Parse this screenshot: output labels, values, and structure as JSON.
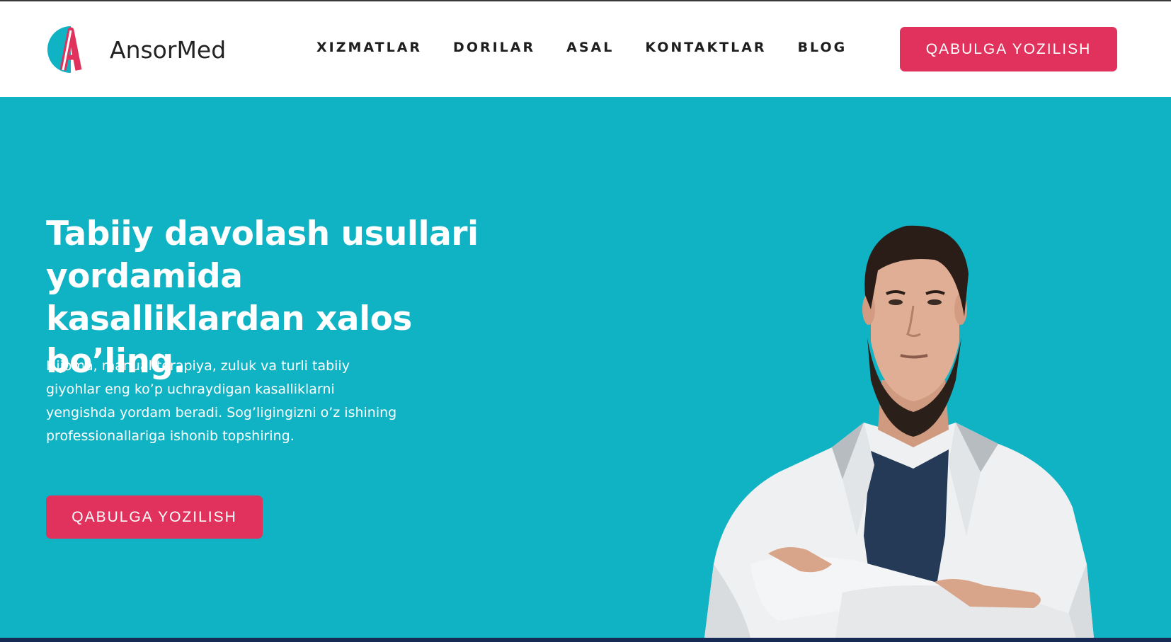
{
  "brand": {
    "name": "AnsorMed",
    "colors": {
      "primary": "#e0325c",
      "teal": "#0fb3c4"
    }
  },
  "nav": {
    "items": [
      {
        "label": "XIZMATLAR"
      },
      {
        "label": "DORILAR"
      },
      {
        "label": "ASAL"
      },
      {
        "label": "KONTAKTLAR"
      },
      {
        "label": "BLOG"
      }
    ],
    "cta_label": "QABULGA YOZILISH"
  },
  "hero": {
    "title_lines": [
      "Tabiiy davolash usullari",
      "yordamida",
      "kasalliklardan xalos bo’ling."
    ],
    "description_lines": [
      "Hijoma, manual terapiya, zuluk va turli tabiiy",
      "giyohlar eng ko’p uchraydigan kasalliklarni",
      "yengishda yordam beradi. Sog’ligingizni o’z ishining",
      "professionallariga ishonib topshiring."
    ],
    "cta_label": "QABULGA YOZILISH",
    "image": "doctor-portrait"
  }
}
